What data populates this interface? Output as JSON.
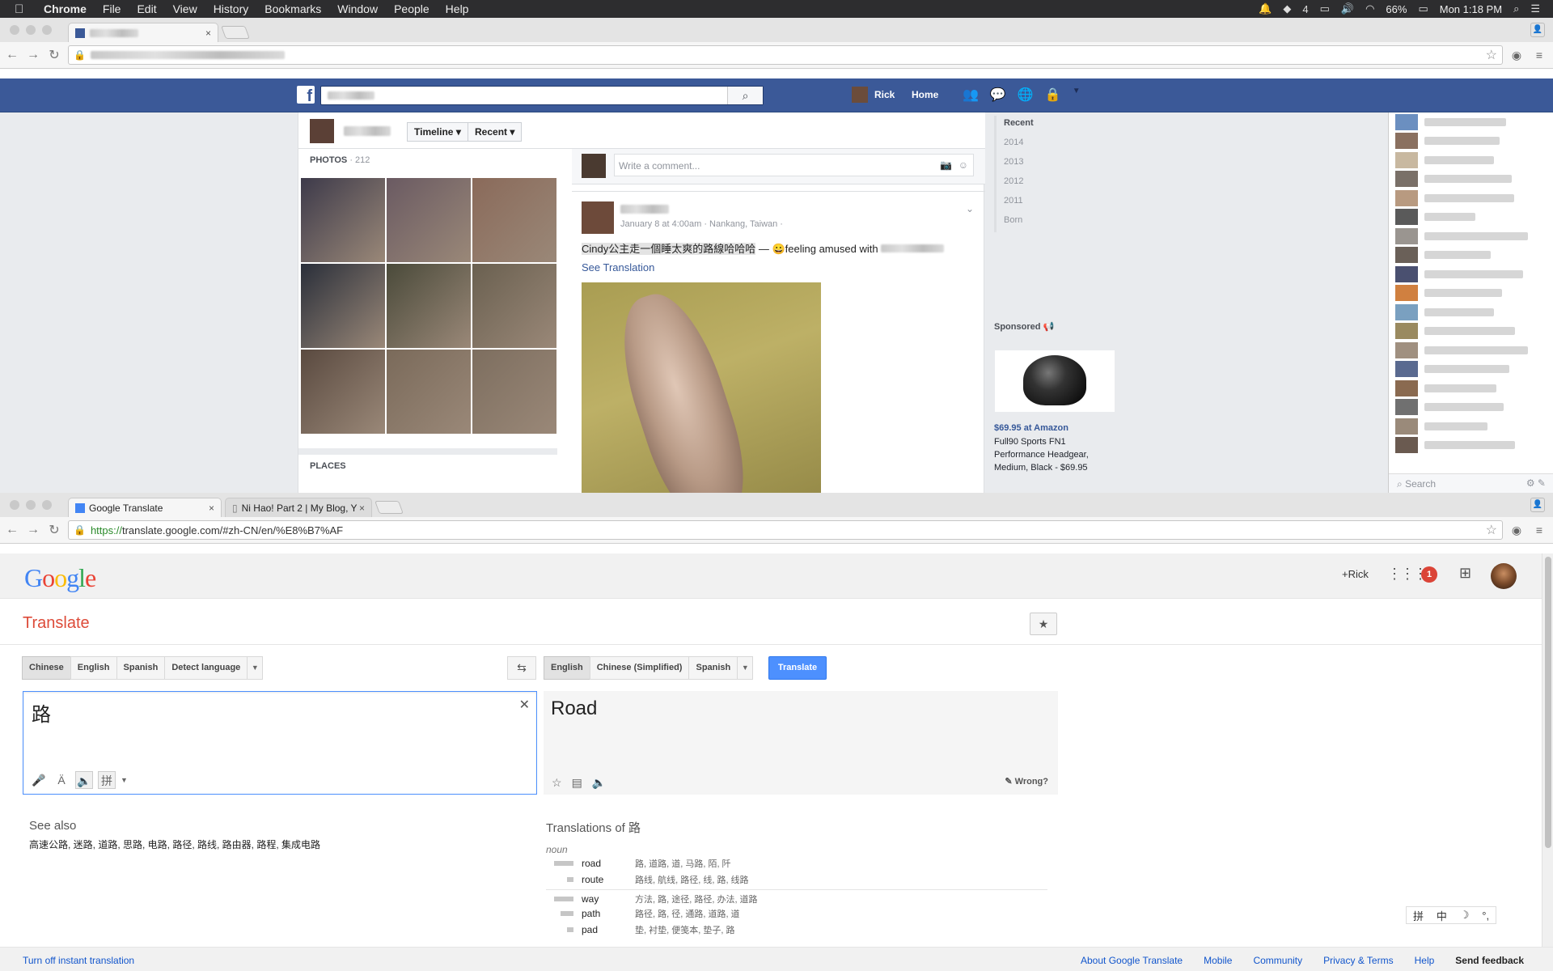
{
  "menubar": {
    "app": "Chrome",
    "items": [
      "File",
      "Edit",
      "View",
      "History",
      "Bookmarks",
      "Window",
      "People",
      "Help"
    ],
    "battery": "66%",
    "clock": "Mon 1:18 PM",
    "badge_count": "4"
  },
  "facebook_window": {
    "tab_close": "×",
    "header": {
      "user_name": "Rick",
      "home_label": "Home"
    },
    "timeline": {
      "timeline_btn": "Timeline",
      "recent_btn": "Recent"
    },
    "photos": {
      "title": "PHOTOS",
      "count": "· 212",
      "colors": [
        "#3d3a4a",
        "#6a5a62",
        "#8a6a5a",
        "#2a2f3a",
        "#4a4a3a",
        "#6a6050",
        "#5a4a40",
        "#7a6a5a",
        "#7d6e5f"
      ]
    },
    "places_title": "PLACES",
    "comment_placeholder": "Write a comment...",
    "post": {
      "meta": "January 8 at 4:00am · Nankang, Taiwan ·",
      "text_chinese": "Cindy公主走一個睡太爽的路線哈哈哈",
      "text_rest": " — 😀feeling amused with",
      "see_translation": "See Translation"
    },
    "year_nav": [
      "Recent",
      "2014",
      "2013",
      "2012",
      "2011",
      "Born"
    ],
    "sponsored": "Sponsored",
    "ad_price": "$69.95 at Amazon",
    "ad_desc": "Full90 Sports FN1 Performance Headgear, Medium, Black - $69.95",
    "chat_search": "Search"
  },
  "translate_window": {
    "tabs": [
      {
        "label": "Google Translate",
        "close": "×"
      },
      {
        "label": "Ni Hao! Part 2 | My Blog, Y",
        "close": "×"
      }
    ],
    "url_https": "https://",
    "url_rest": "translate.google.com/#zh-CN/en/%E8%B7%AF"
  },
  "translate": {
    "plus_user": "+Rick",
    "notifications": "1",
    "title": "Translate",
    "source_langs": [
      "Chinese",
      "English",
      "Spanish",
      "Detect language"
    ],
    "target_langs": [
      "English",
      "Chinese (Simplified)",
      "Spanish"
    ],
    "translate_button": "Translate",
    "source_text": "路",
    "result_text": "Road",
    "wrong_label": "Wrong?",
    "see_also_title": "See also",
    "see_also_list": "高速公路, 迷路, 道路, 思路, 电路, 路径, 路线, 路由器, 路程, 集成电路",
    "translations_title": "Translations of 路",
    "part_of_speech": "noun",
    "translations": [
      {
        "word": "road",
        "syn": "路, 道路, 道, 马路, 陌, 阡",
        "freq": 3
      },
      {
        "word": "route",
        "syn": "路线, 航线, 路径, 线, 路, 线路",
        "freq": 1
      },
      {
        "word": "way",
        "syn": "方法, 路, 途径, 路径, 办法, 道路",
        "freq": 3
      },
      {
        "word": "path",
        "syn": "路径, 路, 径, 通路, 道路, 道",
        "freq": 2
      },
      {
        "word": "pad",
        "syn": "垫, 衬垫, 便笺本, 垫子, 路",
        "freq": 1
      }
    ],
    "ime_chars": [
      "拼",
      "中",
      "☽",
      "°,"
    ],
    "footer_left": "Turn off instant translation",
    "footer_links": [
      "About Google Translate",
      "Mobile",
      "Community",
      "Privacy & Terms",
      "Help"
    ],
    "send_feedback": "Send feedback"
  }
}
